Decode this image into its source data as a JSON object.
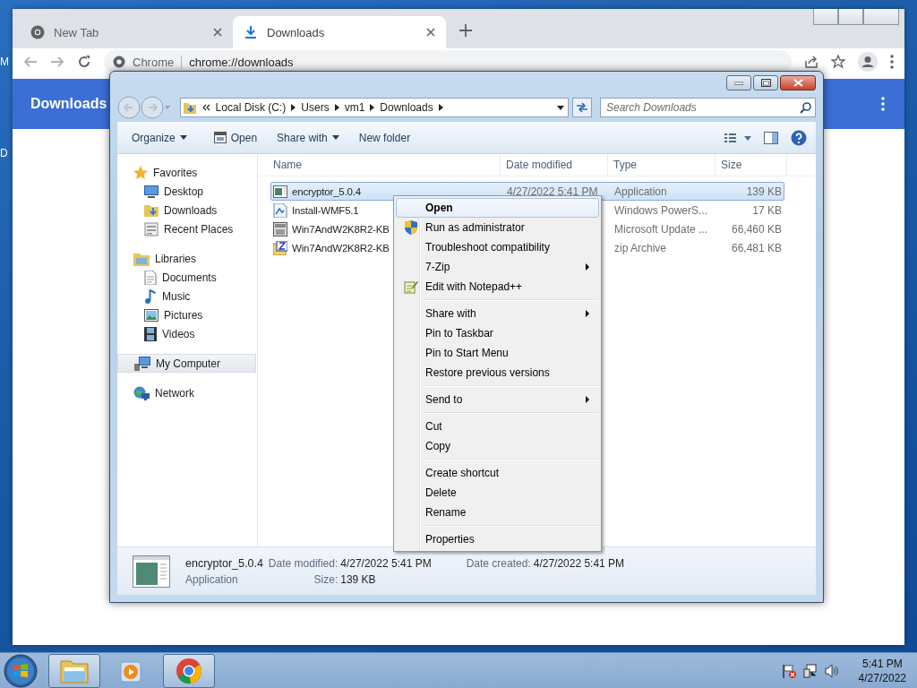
{
  "desktop_labels": [
    "M",
    "D"
  ],
  "browser": {
    "tabs": [
      {
        "label": "New Tab",
        "selected": false
      },
      {
        "label": "Downloads",
        "selected": true
      }
    ],
    "omnibox": {
      "site_label": "Chrome",
      "url": "chrome://downloads"
    },
    "page_header": "Downloads"
  },
  "explorer": {
    "breadcrumb": [
      "Local Disk (C:)",
      "Users",
      "vm1",
      "Downloads"
    ],
    "search": {
      "placeholder": "Search Downloads"
    },
    "commands": [
      {
        "label": "Organize",
        "kind": "menu"
      },
      {
        "label": "Open",
        "kind": "icon"
      },
      {
        "label": "Share with",
        "kind": "menu"
      },
      {
        "label": "New folder",
        "kind": "plain"
      }
    ],
    "navigation": [
      {
        "label": "Favorites",
        "selected": false,
        "children": [
          {
            "label": "Desktop",
            "selected": false
          },
          {
            "label": "Downloads",
            "selected": false
          },
          {
            "label": "Recent Places",
            "selected": false
          }
        ]
      },
      {
        "label": "Libraries",
        "selected": false,
        "children": [
          {
            "label": "Documents",
            "selected": false
          },
          {
            "label": "Music",
            "selected": false
          },
          {
            "label": "Pictures",
            "selected": false
          },
          {
            "label": "Videos",
            "selected": false
          }
        ]
      },
      {
        "label": "My Computer",
        "selected": true
      },
      {
        "label": "Network",
        "selected": false
      }
    ],
    "columns": [
      "Name",
      "Date modified",
      "Type",
      "Size"
    ],
    "files": [
      {
        "name": "encryptor_5.0.4",
        "date_modified": "4/27/2022 5:41 PM",
        "type": "Application",
        "size": "139 KB",
        "selected": true
      },
      {
        "name": "Install-WMF5.1",
        "type": "Windows PowerS...",
        "size": "17 KB",
        "selected": false
      },
      {
        "name": "Win7AndW2K8R2-KB",
        "type": "Microsoft Update ...",
        "size": "66,460 KB",
        "selected": false
      },
      {
        "name": "Win7AndW2K8R2-KB",
        "type": "zip Archive",
        "size": "66,481 KB",
        "selected": false
      }
    ],
    "details": {
      "name": "encryptor_5.0.4",
      "type": "Application",
      "fields": [
        {
          "label": "Date modified:",
          "value": "4/27/2022 5:41 PM"
        },
        {
          "label": "Date created:",
          "value": "4/27/2022 5:41 PM"
        },
        {
          "label": "Size:",
          "value": "139 KB"
        }
      ]
    }
  },
  "context_menu": {
    "groups": [
      [
        {
          "label": "Open",
          "default": true,
          "selected": true,
          "submenu": false
        },
        {
          "label": "Run as administrator",
          "default": false,
          "selected": false,
          "submenu": false
        },
        {
          "label": "Troubleshoot compatibility",
          "default": false,
          "selected": false,
          "submenu": false
        },
        {
          "label": "7-Zip",
          "default": false,
          "selected": false,
          "submenu": true
        },
        {
          "label": "Edit with Notepad++",
          "default": false,
          "selected": false,
          "submenu": false
        }
      ],
      [
        {
          "label": "Share with",
          "default": false,
          "selected": false,
          "submenu": true
        },
        {
          "label": "Pin to Taskbar",
          "default": false,
          "selected": false,
          "submenu": false
        },
        {
          "label": "Pin to Start Menu",
          "default": false,
          "selected": false,
          "submenu": false
        },
        {
          "label": "Restore previous versions",
          "default": false,
          "selected": false,
          "submenu": false
        }
      ],
      [
        {
          "label": "Send to",
          "default": false,
          "selected": false,
          "submenu": true
        }
      ],
      [
        {
          "label": "Cut",
          "default": false,
          "selected": false,
          "submenu": false
        },
        {
          "label": "Copy",
          "default": false,
          "selected": false,
          "submenu": false
        }
      ],
      [
        {
          "label": "Create shortcut",
          "default": false,
          "selected": false,
          "submenu": false
        },
        {
          "label": "Delete",
          "default": false,
          "selected": false,
          "submenu": false
        },
        {
          "label": "Rename",
          "default": false,
          "selected": false,
          "submenu": false
        }
      ],
      [
        {
          "label": "Properties",
          "default": false,
          "selected": false,
          "submenu": false
        }
      ]
    ]
  },
  "taskbar": {
    "buttons": [
      {
        "active": true
      },
      {
        "active": false
      },
      {
        "active": true
      }
    ],
    "clock": {
      "time": "5:41 PM",
      "date": "4/27/2022"
    }
  }
}
